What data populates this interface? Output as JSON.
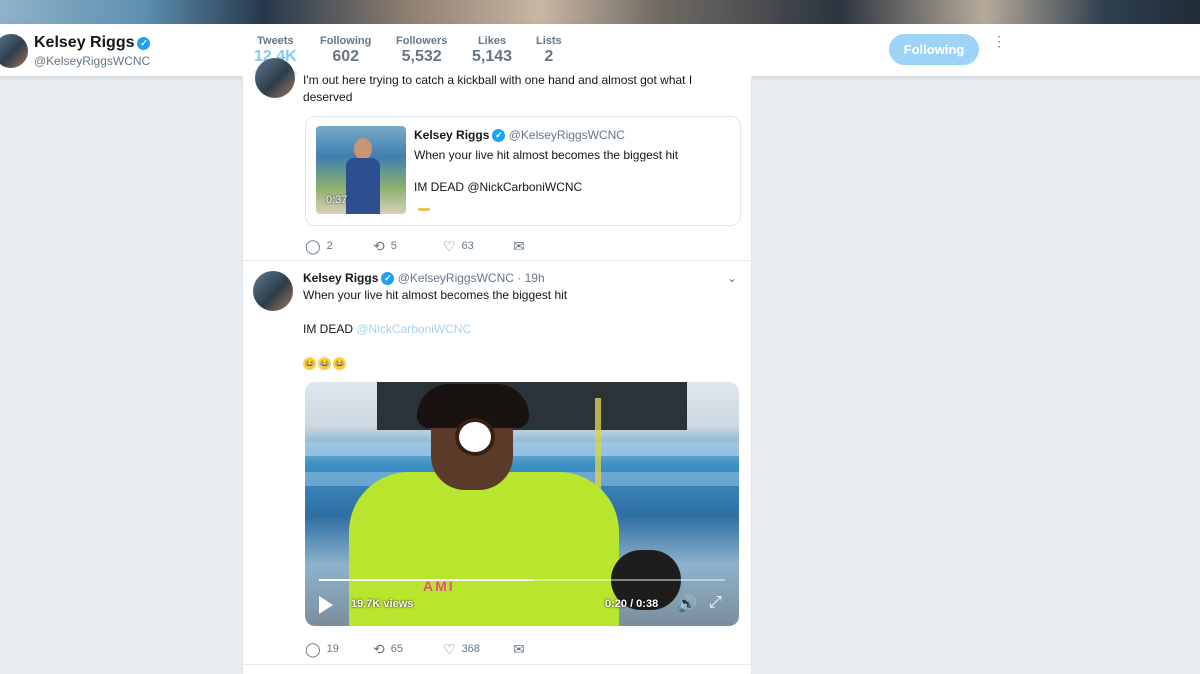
{
  "profile": {
    "name": "Kelsey Riggs",
    "handle": "@KelseyRiggsWCNC",
    "verified_mark": "✓",
    "follow_button": "Following",
    "more_glyph": "⋮"
  },
  "stats": [
    {
      "label": "Tweets",
      "value": "12.4K"
    },
    {
      "label": "Following",
      "value": "602"
    },
    {
      "label": "Followers",
      "value": "5,532"
    },
    {
      "label": "Likes",
      "value": "5,143"
    },
    {
      "label": "Lists",
      "value": "2"
    }
  ],
  "tweet1": {
    "text_line1": "I'm out here trying to catch a kickball with one hand and almost got what I",
    "text_line2": "deserved",
    "quote": {
      "author": "Kelsey Riggs",
      "handle": "@KelseyRiggsWCNC",
      "text": "When your live hit almost becomes the biggest hit",
      "text2": "IM DEAD @NickCarboniWCNC",
      "video_time": "0:37"
    },
    "actions": {
      "replies": "2",
      "retweets": "5",
      "likes": "63"
    }
  },
  "tweet2": {
    "author": "Kelsey Riggs",
    "handle": "@KelseyRiggsWCNC",
    "time": "· 19h",
    "text": "When your live hit almost becomes the biggest hit",
    "text2_prefix": "IM DEAD",
    "mention": "@NickCarboniWCNC",
    "emoji_count": 3,
    "video": {
      "views": "19.7K views",
      "time": "0:20 / 0:38",
      "progress": 0.526,
      "shirt_print": "AMI"
    },
    "actions": {
      "replies": "19",
      "retweets": "65",
      "likes": "368"
    }
  },
  "icons": {
    "reply": "💬",
    "retweet": "⟲",
    "like": "♡",
    "dm": "✉",
    "caret": "⌄",
    "volume": "🔊",
    "fullscreen": "⤢"
  }
}
